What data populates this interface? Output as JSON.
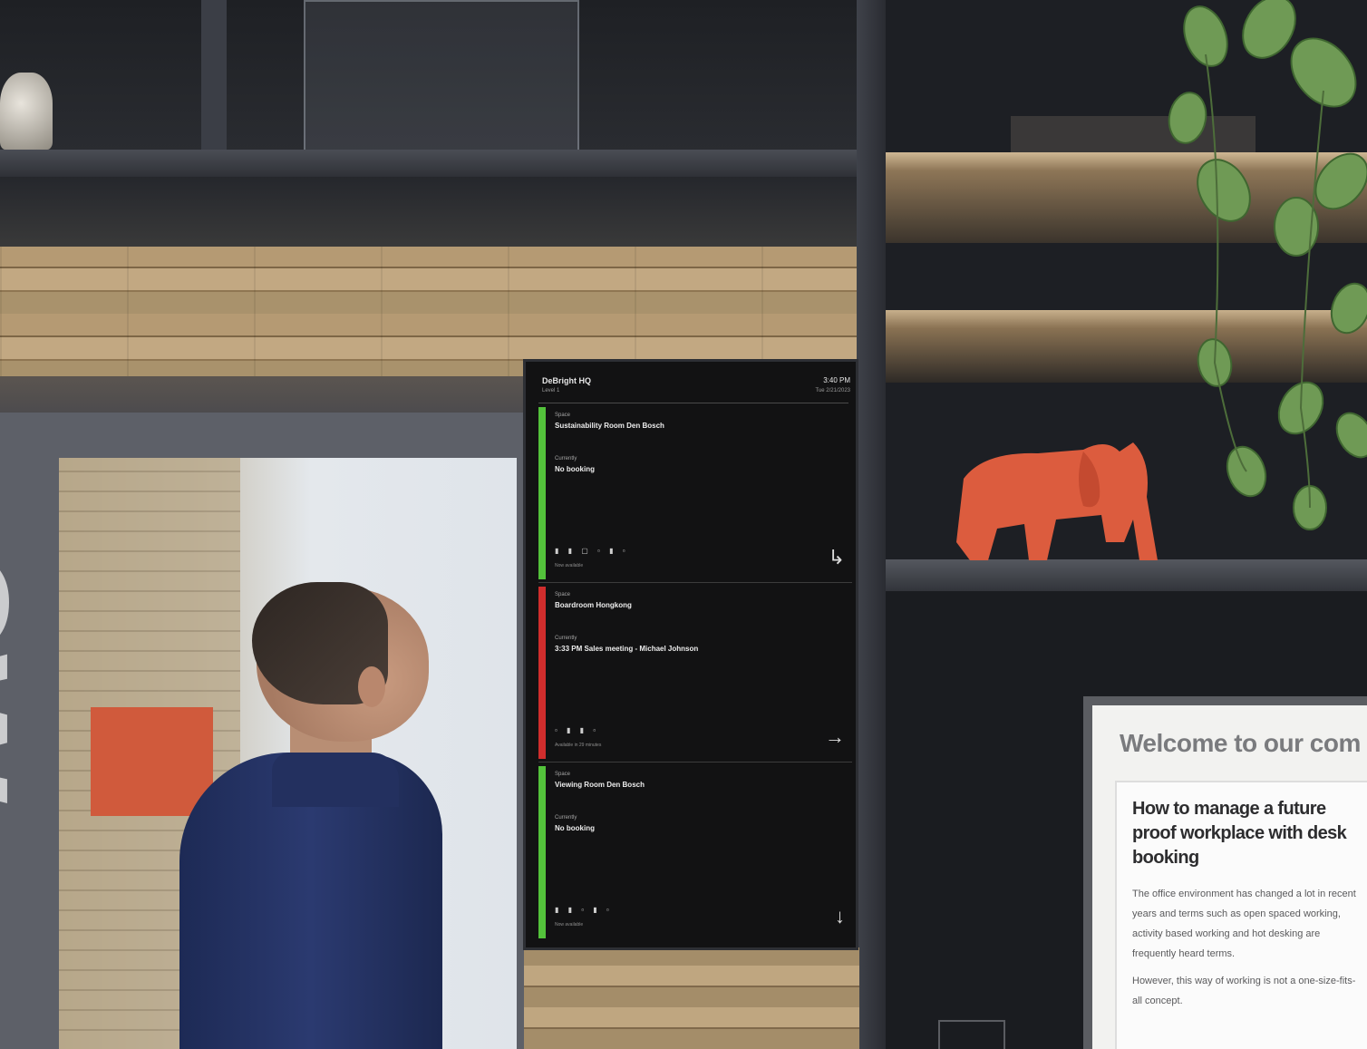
{
  "display": {
    "site": "DeBright HQ",
    "floor": "Level 1",
    "time": "3:40 PM",
    "date": "Tue 2/21/2023",
    "panels": [
      {
        "space_label": "Space",
        "space_name": "Sustainability Room Den Bosch",
        "current_label": "Currently",
        "current_value": "No booking",
        "amenities": "▮ ▮ ▢ ▫ ▮ ▫",
        "footer": "Now available",
        "arrow": "↳",
        "status_color": "#53c23b"
      },
      {
        "space_label": "Space",
        "space_name": "Boardroom Hongkong",
        "current_label": "Currently",
        "current_value": "3:33 PM Sales meeting - Michael Johnson",
        "amenities": "▫ ▮ ▮ ▫",
        "footer": "Available in 29 minutes",
        "arrow": "→",
        "status_color": "#d02d2d"
      },
      {
        "space_label": "Space",
        "space_name": "Viewing Room Den Bosch",
        "current_label": "Currently",
        "current_value": "No booking",
        "amenities": "▮ ▮  ▫ ▮ ▫",
        "footer": "Now available",
        "arrow": "↓",
        "status_color": "#53c23b"
      }
    ]
  },
  "window_lettering": "ow",
  "sign": {
    "title": "Welcome to our com",
    "card_heading": "How to manage a future proof workplace with desk booking",
    "paragraph1": "The office environment has changed a lot in recent years and terms such as open spaced working, activity based working and hot desking are frequently heard terms.",
    "paragraph2": "However, this way of working is not a one-size-fits-all concept."
  },
  "colors": {
    "available": "#53c23b",
    "occupied": "#d02d2d",
    "elephant": "#dc5c3e",
    "shirt": "#243266"
  }
}
